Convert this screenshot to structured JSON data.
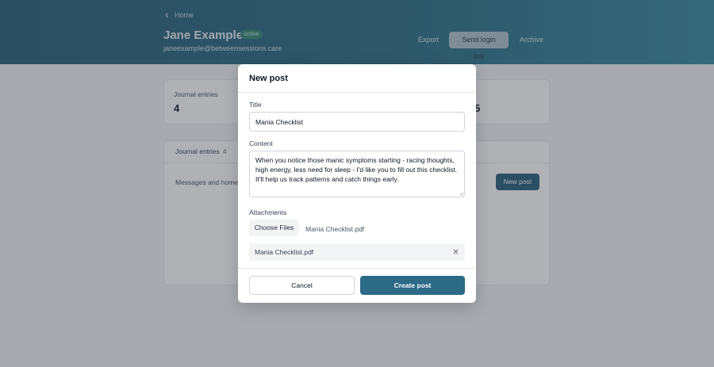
{
  "header": {
    "back_label": "Home",
    "client_name": "Jane Example",
    "status": "active",
    "email": "janeexample@betweensessions.care",
    "actions": {
      "export": "Export",
      "send_login": "Send login link",
      "archive": "Archive"
    }
  },
  "stats": {
    "journal_label": "Journal entries",
    "journal_count": "4",
    "second_count": "5"
  },
  "feed": {
    "tab_label": "Journal entries",
    "tab_count": "4",
    "description": "Messages and homew",
    "new_post_label": "New post"
  },
  "modal": {
    "title": "New post",
    "title_label": "Title",
    "title_value": "Mania Checklist",
    "content_label": "Content",
    "content_value": "When you notice those manic symptoms starting - racing thoughts, high energy, less need for sleep - I'd like you to fill out this checklist. It'll help us track patterns and catch things early.",
    "attachments_label": "Attachments",
    "choose_files_label": "Choose Files",
    "chosen_file": "Mania Checklist.pdf",
    "attached_file": "Mania Checklist.pdf",
    "cancel_label": "Cancel",
    "create_label": "Create post"
  },
  "colors": {
    "header": "#2f6f86",
    "primary_button": "#2c6a86",
    "badge": "#3d8a7a"
  },
  "icons": {
    "back": "chevron-left-icon",
    "remove": "close-icon",
    "resize": "resize-grip-icon"
  }
}
